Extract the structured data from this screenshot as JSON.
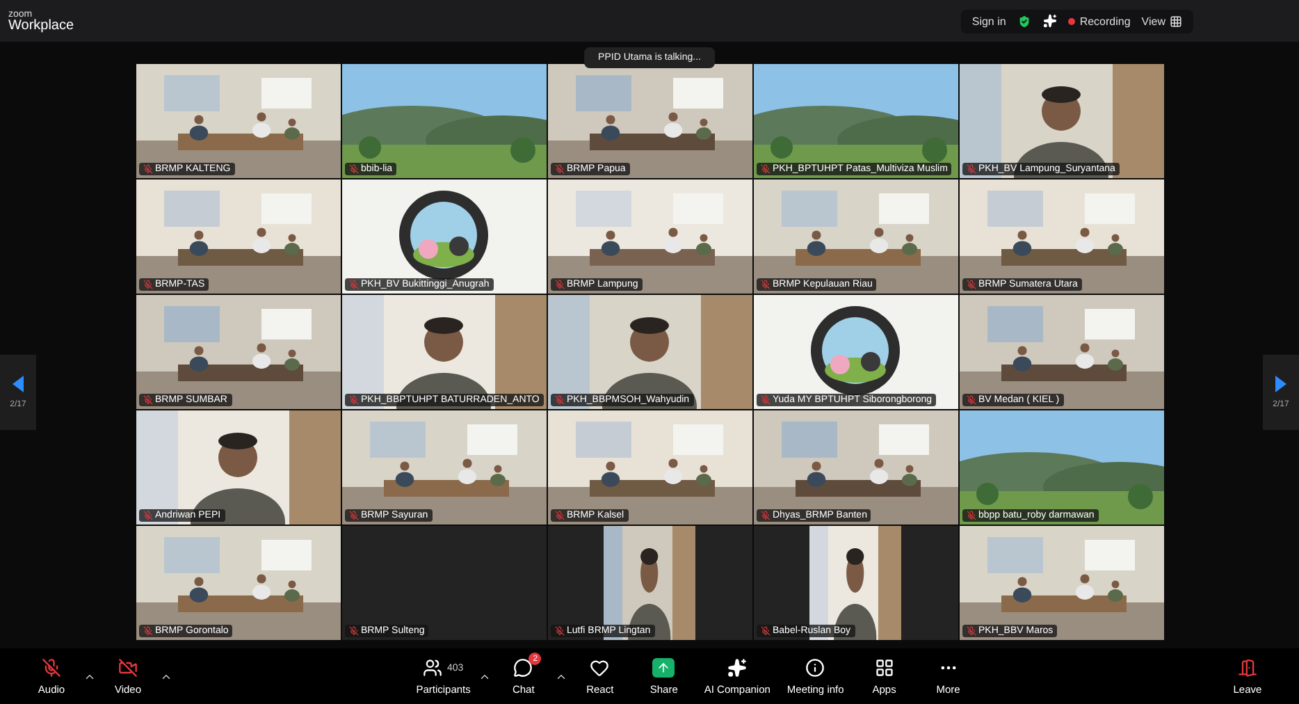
{
  "window": {
    "brand_top": "zoom",
    "brand": "Workplace",
    "sign_in": "Sign in",
    "recording": {
      "label": "Recording",
      "on": true
    },
    "view": "View"
  },
  "talking": "PPID Utama is talking...",
  "pager": {
    "left": "2/17",
    "right": "2/17"
  },
  "tiles": [
    {
      "name": "BRMP KALTENG",
      "kind": "video",
      "muted": true
    },
    {
      "name": "bbib-lia",
      "kind": "video",
      "muted": true
    },
    {
      "name": "BRMP Papua",
      "kind": "video",
      "muted": true
    },
    {
      "name": "PKH_BPTUHPT Patas_Multiviza Muslim",
      "kind": "video",
      "muted": true
    },
    {
      "name": "PKH_BV Lampung_Suryantana",
      "kind": "video",
      "muted": true
    },
    {
      "name": "BRMP-TAS",
      "kind": "video",
      "muted": true
    },
    {
      "name": "PKH_BV Bukittinggi_Anugrah",
      "kind": "video",
      "muted": true
    },
    {
      "name": "BRMP Lampung",
      "kind": "video",
      "muted": true
    },
    {
      "name": "BRMP Kepulauan Riau",
      "kind": "video",
      "muted": true
    },
    {
      "name": "BRMP Sumatera Utara",
      "kind": "video",
      "muted": true
    },
    {
      "name": "BRMP SUMBAR",
      "kind": "video",
      "muted": true
    },
    {
      "name": "PKH_BBPTUHPT BATURRADEN_ANTO",
      "kind": "video",
      "muted": true
    },
    {
      "name": "PKH_BBPMSOH_Wahyudin",
      "kind": "video",
      "muted": true
    },
    {
      "name": "Yuda MY BPTUHPT Siborongborong",
      "kind": "video",
      "muted": true
    },
    {
      "name": "BV Medan ( KIEL )",
      "kind": "video",
      "muted": true
    },
    {
      "name": "Andriwan PEPI",
      "kind": "video",
      "muted": true
    },
    {
      "name": "BRMP Sayuran",
      "kind": "video",
      "muted": true
    },
    {
      "name": "BRMP Kalsel",
      "kind": "video",
      "muted": true
    },
    {
      "name": "Dhyas_BRMP Banten",
      "kind": "video",
      "muted": true
    },
    {
      "name": "bbpp batu_roby darmawan",
      "kind": "video",
      "muted": true
    },
    {
      "name": "BRMP Gorontalo",
      "kind": "video",
      "muted": true
    },
    {
      "name": "BRMP Sulteng",
      "kind": "off",
      "muted": true
    },
    {
      "name": "Lutfi BRMP Lingtan",
      "kind": "letterbox",
      "muted": true
    },
    {
      "name": "Babel-Ruslan Boy",
      "kind": "letterbox",
      "muted": true
    },
    {
      "name": "PKH_BBV Maros",
      "kind": "video",
      "muted": true
    }
  ],
  "toolbar": [
    {
      "kind": "audio",
      "label": "Audio",
      "has_menu": true,
      "off": true
    },
    {
      "kind": "video",
      "label": "Video",
      "has_menu": true,
      "off": true
    },
    {
      "kind": "participants",
      "label": "Participants",
      "count": "403",
      "has_menu": true
    },
    {
      "kind": "chat",
      "label": "Chat",
      "badge": "2",
      "has_menu": true
    },
    {
      "kind": "react",
      "label": "React",
      "has_menu": false
    },
    {
      "kind": "share",
      "label": "Share",
      "has_menu": false
    },
    {
      "kind": "ai",
      "label": "AI Companion",
      "has_menu": false
    },
    {
      "kind": "info",
      "label": "Meeting info",
      "has_menu": false
    },
    {
      "kind": "apps",
      "label": "Apps",
      "has_menu": false
    },
    {
      "kind": "more",
      "label": "More",
      "has_menu": false
    },
    {
      "kind": "leave",
      "label": "Leave",
      "has_menu": false
    }
  ]
}
